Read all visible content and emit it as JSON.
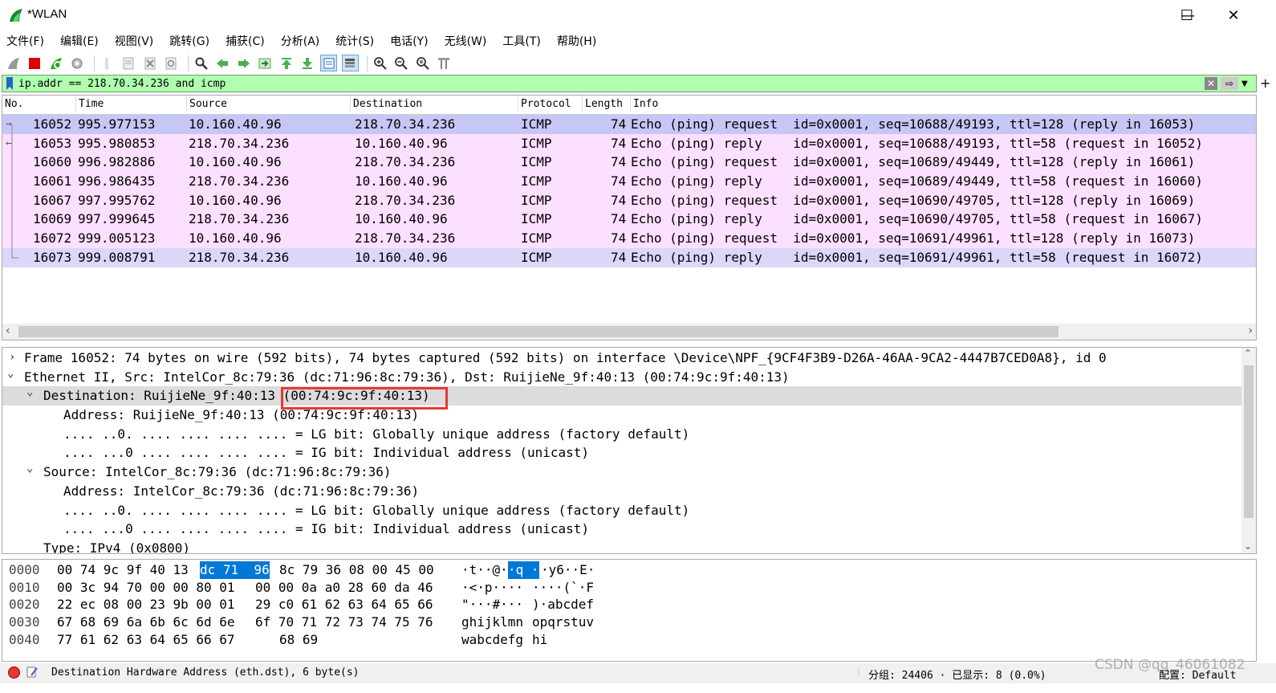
{
  "window": {
    "title": "*WLAN",
    "minimize": "—",
    "maximize": "☐",
    "close": "✕"
  },
  "menu": [
    "文件(F)",
    "编辑(E)",
    "视图(V)",
    "跳转(G)",
    "捕获(C)",
    "分析(A)",
    "统计(S)",
    "电话(Y)",
    "无线(W)",
    "工具(T)",
    "帮助(H)"
  ],
  "filter": {
    "value": "ip.addr == 218.70.34.236 and icmp",
    "plus": "+"
  },
  "packet_list": {
    "columns": [
      "No.",
      "Time",
      "Source",
      "Destination",
      "Protocol",
      "Length",
      "Info"
    ],
    "rows": [
      {
        "no": "16052",
        "time": "995.977153",
        "src": "10.160.40.96",
        "dst": "218.70.34.236",
        "proto": "ICMP",
        "len": "74",
        "info": "Echo (ping) request  id=0x0001, seq=10688/49193, ttl=128 (reply in 16053)"
      },
      {
        "no": "16053",
        "time": "995.980853",
        "src": "218.70.34.236",
        "dst": "10.160.40.96",
        "proto": "ICMP",
        "len": "74",
        "info": "Echo (ping) reply    id=0x0001, seq=10688/49193, ttl=58 (request in 16052)"
      },
      {
        "no": "16060",
        "time": "996.982886",
        "src": "10.160.40.96",
        "dst": "218.70.34.236",
        "proto": "ICMP",
        "len": "74",
        "info": "Echo (ping) request  id=0x0001, seq=10689/49449, ttl=128 (reply in 16061)"
      },
      {
        "no": "16061",
        "time": "996.986435",
        "src": "218.70.34.236",
        "dst": "10.160.40.96",
        "proto": "ICMP",
        "len": "74",
        "info": "Echo (ping) reply    id=0x0001, seq=10689/49449, ttl=58 (request in 16060)"
      },
      {
        "no": "16067",
        "time": "997.995762",
        "src": "10.160.40.96",
        "dst": "218.70.34.236",
        "proto": "ICMP",
        "len": "74",
        "info": "Echo (ping) request  id=0x0001, seq=10690/49705, ttl=128 (reply in 16069)"
      },
      {
        "no": "16069",
        "time": "997.999645",
        "src": "218.70.34.236",
        "dst": "10.160.40.96",
        "proto": "ICMP",
        "len": "74",
        "info": "Echo (ping) reply    id=0x0001, seq=10690/49705, ttl=58 (request in 16067)"
      },
      {
        "no": "16072",
        "time": "999.005123",
        "src": "10.160.40.96",
        "dst": "218.70.34.236",
        "proto": "ICMP",
        "len": "74",
        "info": "Echo (ping) request  id=0x0001, seq=10691/49961, ttl=128 (reply in 16073)"
      },
      {
        "no": "16073",
        "time": "999.008791",
        "src": "218.70.34.236",
        "dst": "10.160.40.96",
        "proto": "ICMP",
        "len": "74",
        "info": "Echo (ping) reply    id=0x0001, seq=10691/49961, ttl=58 (request in 16072)"
      }
    ]
  },
  "details": [
    {
      "caret": "›",
      "text": "Frame 16052: 74 bytes on wire (592 bits), 74 bytes captured (592 bits) on interface \\Device\\NPF_{9CF4F3B9-D26A-46AA-9CA2-4447B7CED0A8}, id 0"
    },
    {
      "caret": "⌄",
      "text": "Ethernet II, Src: IntelCor_8c:79:36 (dc:71:96:8c:79:36), Dst: RuijieNe_9f:40:13 (00:74:9c:9f:40:13)"
    },
    {
      "caret": "⌄",
      "text": "Destination: RuijieNe_9f:40:13 (00:74:9c:9f:40:13)"
    },
    {
      "caret": "",
      "text": "Address: RuijieNe_9f:40:13 (00:74:9c:9f:40:13)"
    },
    {
      "caret": "",
      "text": ".... ..0. .... .... .... .... = LG bit: Globally unique address (factory default)"
    },
    {
      "caret": "",
      "text": ".... ...0 .... .... .... .... = IG bit: Individual address (unicast)"
    },
    {
      "caret": "⌄",
      "text": "Source: IntelCor_8c:79:36 (dc:71:96:8c:79:36)"
    },
    {
      "caret": "",
      "text": "Address: IntelCor_8c:79:36 (dc:71:96:8c:79:36)"
    },
    {
      "caret": "",
      "text": ".... ..0. .... .... .... .... = LG bit: Globally unique address (factory default)"
    },
    {
      "caret": "",
      "text": ".... ...0 .... .... .... .... = IG bit: Individual address (unicast)"
    },
    {
      "caret": "",
      "text": "Type: IPv4 (0x0800)"
    }
  ],
  "bytes": [
    {
      "off": "0000",
      "hex_a": "00 74 9c 9f 40 13",
      "hex_sel": "dc 71  96",
      "hex_b": "8c 79 36 08 00 45 00",
      "ascii_a": "·t··@·",
      "ascii_sel": "·q ·",
      "ascii_b": "·y6··E·"
    },
    {
      "off": "0010",
      "hex_a": "00 3c 94 70 00 00 80 01",
      "hex_sel": "",
      "hex_b": "00 00 0a a0 28 60 da 46",
      "ascii_a": "·<·p····",
      "ascii_sel": "",
      "ascii_b": "····(`·F"
    },
    {
      "off": "0020",
      "hex_a": "22 ec 08 00 23 9b 00 01",
      "hex_sel": "",
      "hex_b": "29 c0 61 62 63 64 65 66",
      "ascii_a": "\"···#···",
      "ascii_sel": "",
      "ascii_b": ")·abcdef"
    },
    {
      "off": "0030",
      "hex_a": "67 68 69 6a 6b 6c 6d 6e",
      "hex_sel": "",
      "hex_b": "6f 70 71 72 73 74 75 76",
      "ascii_a": "ghijklmn",
      "ascii_sel": "",
      "ascii_b": "opqrstuv"
    },
    {
      "off": "0040",
      "hex_a": "77 61 62 63 64 65 66 67",
      "hex_sel": "",
      "hex_b": "68 69",
      "ascii_a": "wabcdefg",
      "ascii_sel": "",
      "ascii_b": "hi"
    }
  ],
  "status": {
    "field": "Destination Hardware Address (eth.dst), 6 byte(s)",
    "packets": "分组: 24406 · 已显示: 8 (0.0%)",
    "profile": "配置: Default"
  },
  "watermark": "CSDN @qq_46061082",
  "colors": {
    "filter_bg": "#afffaf",
    "selected_row": "#c6c7f7",
    "icmp_row": "#fce0ff",
    "byte_highlight": "#0078d7",
    "highlight_box": "#e53935"
  }
}
